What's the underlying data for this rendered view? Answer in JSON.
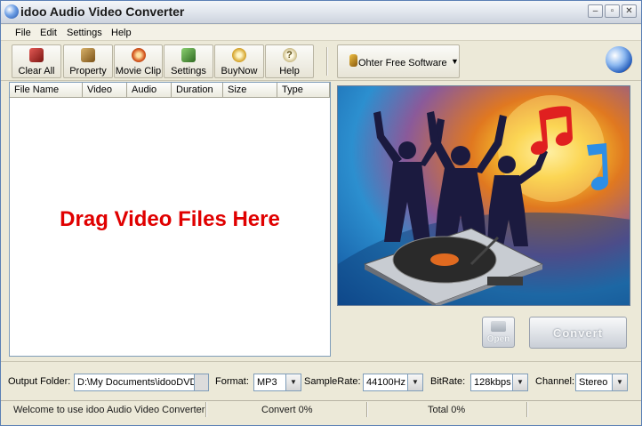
{
  "app": {
    "title": "idoo Audio Video Converter"
  },
  "titlebar": {
    "minimize": "–",
    "maximize": "▫",
    "close": "✕"
  },
  "menu": [
    "File",
    "Edit",
    "Settings",
    "Help"
  ],
  "toolbar": {
    "buttons": [
      {
        "label": "Clear All",
        "icon": "clear-all-icon",
        "color": "#b8312f"
      },
      {
        "label": "Property",
        "icon": "property-icon",
        "color": "#a67a2e"
      },
      {
        "label": "Movie Clip",
        "icon": "movie-clip-icon",
        "color": "#c0502a"
      },
      {
        "label": "Settings",
        "icon": "settings-icon",
        "color": "#4a8b3a"
      },
      {
        "label": "BuyNow",
        "icon": "buy-now-icon",
        "color": "#c39b2e"
      },
      {
        "label": "Help",
        "icon": "help-icon",
        "color": "#b0a070"
      }
    ],
    "other_software": "Ohter Free Software"
  },
  "filelist": {
    "columns": [
      "File Name",
      "Video",
      "Audio",
      "Duration",
      "Size",
      "Type"
    ],
    "drop_hint": "Drag Video Files Here"
  },
  "actions": {
    "open": "Open",
    "convert": "Convert"
  },
  "output": {
    "folder_label": "Output Folder:",
    "folder_value": "D:\\My Documents\\idooDVD\\",
    "format_label": "Format:",
    "format_value": "MP3",
    "samplerate_label": "SampleRate:",
    "samplerate_value": "44100Hz",
    "bitrate_label": "BitRate:",
    "bitrate_value": "128kbps",
    "channel_label": "Channel:",
    "channel_value": "Stereo"
  },
  "status": {
    "welcome": "Welcome to use idoo Audio Video Converter",
    "convert": "Convert 0%",
    "total": "Total 0%"
  },
  "colors": {
    "drop_hint": "#e00000",
    "window_frame": "#ece9d8"
  }
}
